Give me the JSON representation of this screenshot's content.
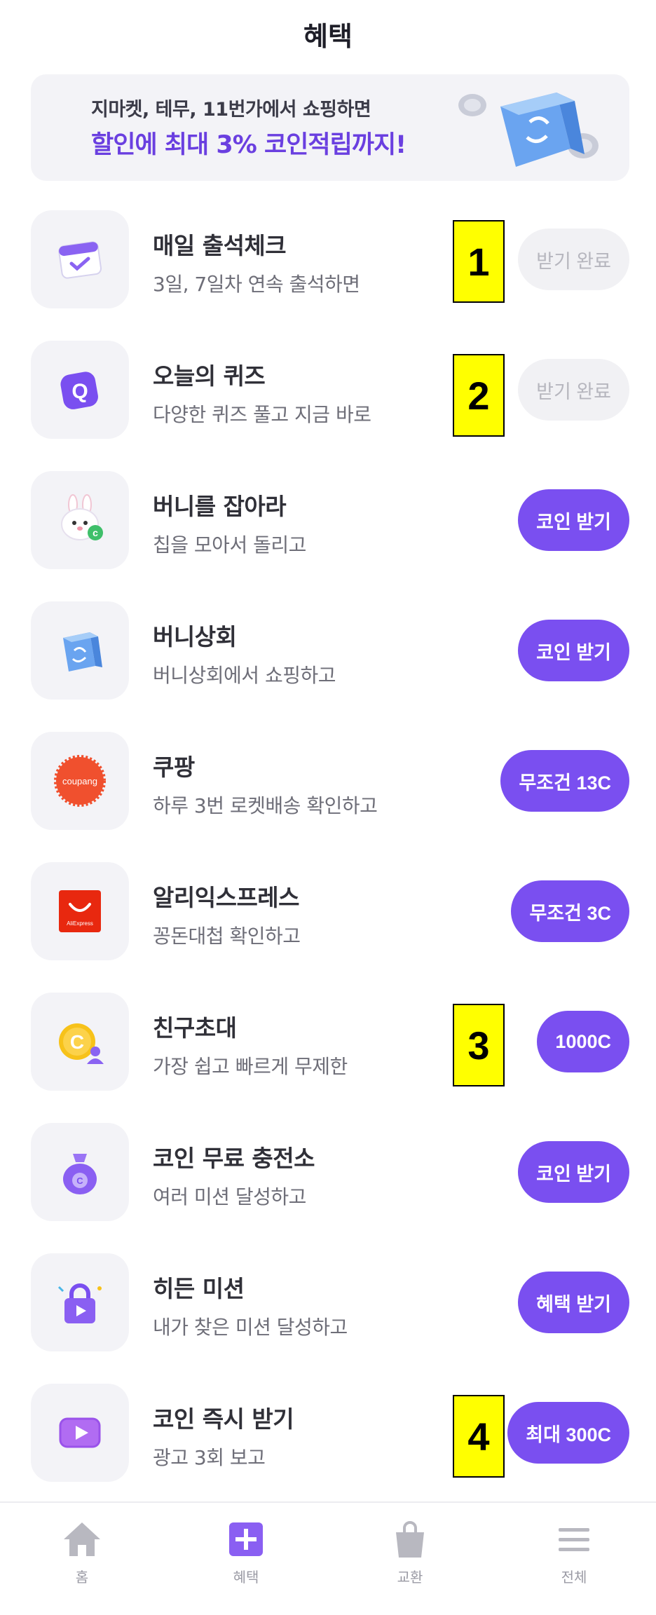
{
  "header": {
    "title": "혜택"
  },
  "banner": {
    "line1": "지마켓, 테무, 11번가에서 쇼핑하면",
    "line2": "할인에 최대 3% 코인적립까지!"
  },
  "items": [
    {
      "title": "매일 출석체크",
      "subtitle": "3일, 7일차 연속 출석하면",
      "button": "받기 완료",
      "icon": "calendar-check-icon"
    },
    {
      "title": "오늘의 퀴즈",
      "subtitle": "다양한 퀴즈 풀고 지금 바로",
      "button": "받기 완료",
      "icon": "quiz-q-icon"
    },
    {
      "title": "버니를 잡아라",
      "subtitle": "칩을 모아서 돌리고",
      "button": "코인 받기",
      "icon": "bunny-icon"
    },
    {
      "title": "버니상회",
      "subtitle": "버니상회에서 쇼핑하고",
      "button": "코인 받기",
      "icon": "shopping-bag-icon"
    },
    {
      "title": "쿠팡",
      "subtitle": "하루 3번 로켓배송 확인하고",
      "button": "무조건 13C",
      "icon": "coupang-logo-icon",
      "logo_text": "coupang"
    },
    {
      "title": "알리익스프레스",
      "subtitle": "꽁돈대첩 확인하고",
      "button": "무조건 3C",
      "icon": "aliexpress-logo-icon",
      "logo_text": "AliExpress"
    },
    {
      "title": "친구초대",
      "subtitle": "가장 쉽고 빠르게 무제한",
      "button": "1000C",
      "icon": "invite-coin-icon"
    },
    {
      "title": "코인 무료 충전소",
      "subtitle": "여러 미션 달성하고",
      "button": "코인 받기",
      "icon": "coin-pouch-icon"
    },
    {
      "title": "히든 미션",
      "subtitle": "내가 찾은 미션 달성하고",
      "button": "혜택 받기",
      "icon": "locked-video-icon"
    },
    {
      "title": "코인 즉시 받기",
      "subtitle": "광고 3회 보고",
      "button": "최대 300C",
      "icon": "video-play-icon"
    }
  ],
  "markers": [
    "1",
    "2",
    "3",
    "4"
  ],
  "nav": [
    {
      "label": "홈",
      "icon": "home-icon"
    },
    {
      "label": "혜택",
      "icon": "plus-box-icon"
    },
    {
      "label": "교환",
      "icon": "bag-icon"
    },
    {
      "label": "전체",
      "icon": "menu-icon"
    }
  ],
  "colors": {
    "accent": "#7a4ff0",
    "done_bg": "#f1f1f4",
    "done_text": "#b6b6be",
    "marker": "#ffff00"
  }
}
